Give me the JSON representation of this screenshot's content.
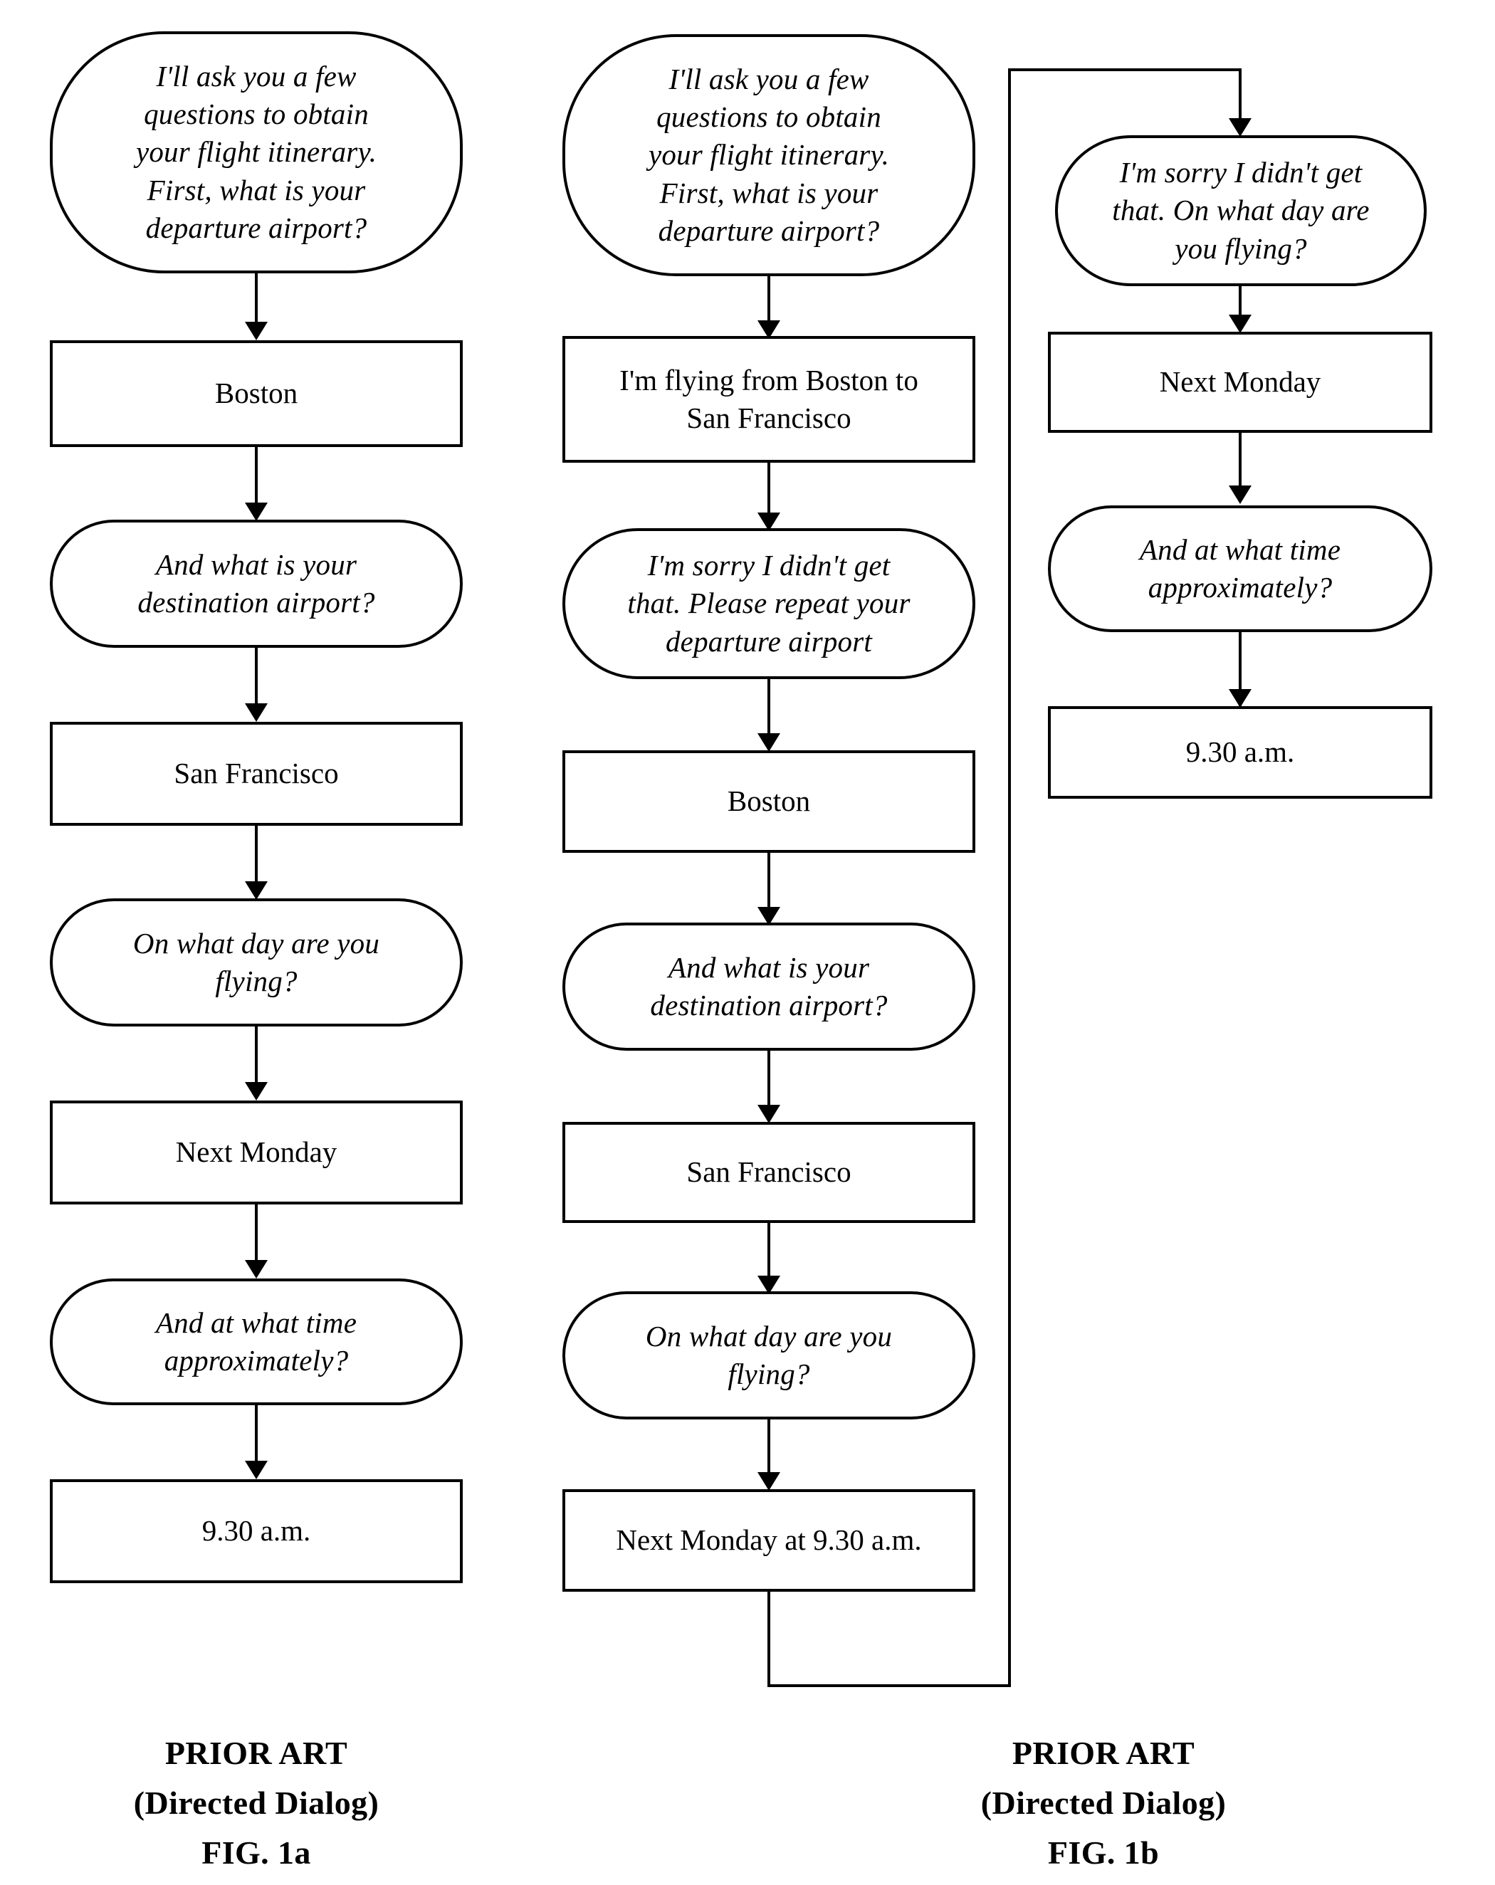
{
  "figure": {
    "title": "Directed Dialog prior art flowcharts",
    "line_color": "#000000",
    "background_color": "#ffffff"
  },
  "columns": [
    {
      "id": "fig-1a",
      "caption": {
        "line1": "PRIOR ART",
        "line2": "(Directed Dialog)",
        "line3": "FIG. 1a"
      },
      "nodes": [
        {
          "id": "a1",
          "kind": "prompt",
          "text": "I'll ask you a few\nquestions to obtain\nyour flight itinerary.\nFirst, what is your\ndeparture airport?"
        },
        {
          "id": "a2",
          "kind": "response",
          "text": "Boston"
        },
        {
          "id": "a3",
          "kind": "prompt",
          "text": "And what is your\ndestination airport?"
        },
        {
          "id": "a4",
          "kind": "response",
          "text": "San Francisco"
        },
        {
          "id": "a5",
          "kind": "prompt",
          "text": "On what day are you\nflying?"
        },
        {
          "id": "a6",
          "kind": "response",
          "text": "Next Monday"
        },
        {
          "id": "a7",
          "kind": "prompt",
          "text": "And at what time\napproximately?"
        },
        {
          "id": "a8",
          "kind": "response",
          "text": "9.30 a.m."
        }
      ]
    },
    {
      "id": "fig-1b",
      "caption": {
        "line1": "PRIOR ART",
        "line2": "(Directed Dialog)",
        "line3": "FIG. 1b"
      },
      "nodes": [
        {
          "id": "b1",
          "kind": "prompt",
          "text": "I'll ask you a few\nquestions to obtain\nyour flight itinerary.\nFirst, what is your\ndeparture airport?"
        },
        {
          "id": "b2",
          "kind": "response",
          "text": "I'm flying from Boston to\nSan Francisco"
        },
        {
          "id": "b3",
          "kind": "prompt",
          "text": "I'm sorry I didn't get\nthat. Please repeat your\ndeparture airport"
        },
        {
          "id": "b4",
          "kind": "response",
          "text": "Boston"
        },
        {
          "id": "b5",
          "kind": "prompt",
          "text": "And what is your\ndestination airport?"
        },
        {
          "id": "b6",
          "kind": "response",
          "text": "San Francisco"
        },
        {
          "id": "b7",
          "kind": "prompt",
          "text": "On what day are you\nflying?"
        },
        {
          "id": "b8",
          "kind": "response",
          "text": "Next Monday at 9.30 a.m."
        },
        {
          "id": "b9",
          "kind": "prompt",
          "text": "I'm sorry I didn't get\nthat. On what day are\nyou flying?"
        },
        {
          "id": "b10",
          "kind": "response",
          "text": "Next Monday"
        },
        {
          "id": "b11",
          "kind": "prompt",
          "text": "And at what time\napproximately?"
        },
        {
          "id": "b12",
          "kind": "response",
          "text": "9.30 a.m."
        }
      ]
    }
  ]
}
